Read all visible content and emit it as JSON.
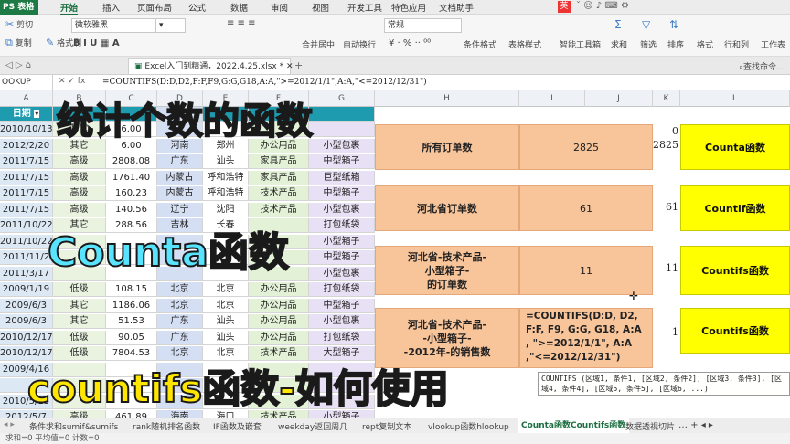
{
  "app": {
    "name": "PS 表格"
  },
  "menu": [
    "开始",
    "插入",
    "页面布局",
    "公式",
    "数据",
    "审阅",
    "视图",
    "开发工具",
    "特色应用",
    "文档助手"
  ],
  "ribbon": {
    "cut": "剪切",
    "copy": "复制",
    "format_painter": "格式刷",
    "font_name": "微软雅黑",
    "merge_center": "合并居中",
    "wrap_text": "自动换行",
    "number_format": "常规",
    "conditional_format": "条件格式",
    "table_style": "表格样式",
    "smart_toolbox": "智能工具箱",
    "sum": "求和",
    "filter": "筛选",
    "sort": "排序",
    "format": "格式",
    "row_col": "行和列",
    "worksheet": "工作表",
    "find": "查找命令..."
  },
  "file_tab": "Excel入门到精通，2022.4.25.xlsx *",
  "formula_bar": {
    "name_box": "OOKUP",
    "formula": "=COUNTIFS(D:D,D2,F:F,F9,G:G,G18,A:A,\">=2012/1/1\",A:A,\"<=2012/12/31\")"
  },
  "columns": [
    "A",
    "B",
    "C",
    "D",
    "E",
    "F",
    "G",
    "H",
    "I",
    "J",
    "K",
    "L"
  ],
  "header_row": {
    "a1": "日期"
  },
  "rows": [
    {
      "a": "2010/10/13",
      "b": "其它",
      "c": "6.00",
      "d": "",
      "e": "",
      "f": "",
      "g": ""
    },
    {
      "a": "2012/2/20",
      "b": "其它",
      "c": "6.00",
      "d": "河南",
      "e": "郑州",
      "f": "办公用品",
      "g": "小型包裹"
    },
    {
      "a": "2011/7/15",
      "b": "高级",
      "c": "2808.08",
      "d": "广东",
      "e": "汕头",
      "f": "家具产品",
      "g": "中型箱子"
    },
    {
      "a": "2011/7/15",
      "b": "高级",
      "c": "1761.40",
      "d": "内蒙古",
      "e": "呼和浩特",
      "f": "家具产品",
      "g": "巨型纸箱"
    },
    {
      "a": "2011/7/15",
      "b": "高级",
      "c": "160.23",
      "d": "内蒙古",
      "e": "呼和浩特",
      "f": "技术产品",
      "g": "中型箱子"
    },
    {
      "a": "2011/7/15",
      "b": "高级",
      "c": "140.56",
      "d": "辽宁",
      "e": "沈阳",
      "f": "技术产品",
      "g": "小型包裹"
    },
    {
      "a": "2011/10/22",
      "b": "其它",
      "c": "288.56",
      "d": "吉林",
      "e": "长春",
      "f": "",
      "g": "打包纸袋"
    },
    {
      "a": "2011/10/22",
      "b": "",
      "c": "",
      "d": "",
      "e": "",
      "f": "",
      "g": "小型箱子"
    },
    {
      "a": "2011/11/2",
      "b": "",
      "c": "",
      "d": "",
      "e": "",
      "f": "",
      "g": "中型箱子"
    },
    {
      "a": "2011/3/17",
      "b": "",
      "c": "",
      "d": "",
      "e": "",
      "f": "",
      "g": "小型包裹"
    },
    {
      "a": "2009/1/19",
      "b": "低级",
      "c": "108.15",
      "d": "北京",
      "e": "北京",
      "f": "办公用品",
      "g": "打包纸袋"
    },
    {
      "a": "2009/6/3",
      "b": "其它",
      "c": "1186.06",
      "d": "北京",
      "e": "北京",
      "f": "办公用品",
      "g": "中型箱子"
    },
    {
      "a": "2009/6/3",
      "b": "其它",
      "c": "51.53",
      "d": "广东",
      "e": "汕头",
      "f": "办公用品",
      "g": "小型包裹"
    },
    {
      "a": "2010/12/17",
      "b": "低级",
      "c": "90.05",
      "d": "广东",
      "e": "汕头",
      "f": "办公用品",
      "g": "打包纸袋"
    },
    {
      "a": "2010/12/17",
      "b": "低级",
      "c": "7804.53",
      "d": "北京",
      "e": "北京",
      "f": "技术产品",
      "g": "大型箱子"
    },
    {
      "a": "2009/4/16",
      "b": "",
      "c": "",
      "d": "",
      "e": "",
      "f": "",
      "g": ""
    },
    {
      "a": "",
      "b": "",
      "c": "",
      "d": "",
      "e": "",
      "f": "",
      "g": ""
    },
    {
      "a": "2010/5/15",
      "b": "",
      "c": "",
      "d": "",
      "e": "",
      "f": "",
      "g": ""
    },
    {
      "a": "2012/5/7",
      "b": "高级",
      "c": "461.89",
      "d": "海南",
      "e": "海口",
      "f": "技术产品",
      "g": "小型箱子"
    }
  ],
  "summary": [
    {
      "label_lines": [
        "所有订单数"
      ],
      "value": "2825",
      "k": "2825",
      "button": "Counta函数"
    },
    {
      "label_lines": [
        "河北省订单数"
      ],
      "value": "61",
      "k": "61",
      "button": "Countif函数"
    },
    {
      "label_lines": [
        "河北省-技术产品-",
        "小型箱子-",
        "的订单数"
      ],
      "value": "11",
      "k": "11",
      "button": "Countifs函数"
    },
    {
      "label_lines": [
        "河北省-技术产品-",
        "-小型箱子-",
        "-2012年-的销售数"
      ],
      "value": "",
      "k": "1",
      "button": "Countifs函数"
    }
  ],
  "k_top": "0",
  "edit_formula_lines": [
    "=COUNTIFS(D:D, D2,",
    "F:F, F9, G:G, G18, A:A",
    ", \">=2012/1/1\", A:A",
    ",\"<=2012/12/31\")"
  ],
  "tooltip": "COUNTIFS (区域1, 条件1, [区域2, 条件2], [区域3, 条件3], [区域4, 条件4], [区域5, 条件5], [区域6, ...)",
  "overlays": {
    "title": "统计个数的函数",
    "counta": "Counta函数",
    "countifs": "countifs函数-如何使用"
  },
  "sheet_tabs": [
    "条件求和sumif&sumifs",
    "rank随机排名函数",
    "IF函数及嵌套",
    "weekday返回周几",
    "rept复制文本",
    "vlookup函数hlookup",
    "Counta函数Countifs函数",
    "数据透视切片"
  ],
  "active_sheet": "Counta函数Countifs函数",
  "status_bar": "求和=0  平均值=0  计数=0",
  "colors": {
    "orange": "#f8c49a",
    "yellow": "#ffff00",
    "green": "#1d6f42",
    "teal_header": "#1f9bb0"
  }
}
